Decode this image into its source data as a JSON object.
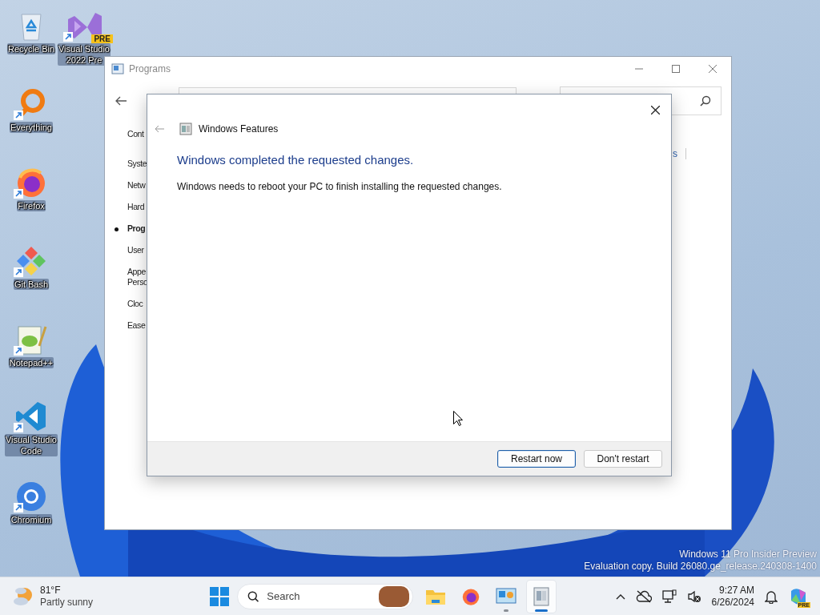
{
  "desktop_icons": [
    {
      "label": "Recycle Bin",
      "kind": "recycle",
      "shortcut": false
    },
    {
      "label": "Visual Studio\n2022 Pre",
      "kind": "vs-preview",
      "shortcut": true,
      "badge": "PRE"
    },
    {
      "label": "Everything",
      "kind": "everything",
      "shortcut": true
    },
    {
      "label": "Firefox",
      "kind": "firefox",
      "shortcut": true
    },
    {
      "label": "Git Bash",
      "kind": "gitbash",
      "shortcut": true
    },
    {
      "label": "Notepad++",
      "kind": "notepad",
      "shortcut": true
    },
    {
      "label": "Visual Studio\nCode",
      "kind": "vscode",
      "shortcut": true
    },
    {
      "label": "Chromium",
      "kind": "chromium",
      "shortcut": true
    }
  ],
  "programs_window": {
    "title": "Programs",
    "sidebar": [
      {
        "label": "Cont",
        "selected": false
      },
      {
        "label": "Syste",
        "selected": false
      },
      {
        "label": "Netw",
        "selected": false
      },
      {
        "label": "Hard",
        "selected": false
      },
      {
        "label": "Prog",
        "selected": true
      },
      {
        "label": "User",
        "selected": false
      },
      {
        "label": "Appe\nPerso",
        "selected": false
      },
      {
        "label": "Cloc",
        "selected": false
      },
      {
        "label": "Ease",
        "selected": false
      }
    ],
    "right_link": "s"
  },
  "dialog": {
    "title": "Windows Features",
    "heading": "Windows completed the requested changes.",
    "message": "Windows needs to reboot your PC to finish installing the requested changes.",
    "buttons": [
      {
        "label": "Restart now",
        "default": true
      },
      {
        "label": "Don't restart",
        "default": false
      }
    ]
  },
  "watermark": {
    "line1": "Windows 11 Pro Insider Preview",
    "line2": "Evaluation copy. Build 26080.ge_release.240308-1400"
  },
  "taskbar": {
    "weather": {
      "temperature": "81°F",
      "condition": "Partly sunny"
    },
    "search": {
      "placeholder": "Search"
    },
    "apps": [
      {
        "kind": "folder",
        "running": false,
        "active": false
      },
      {
        "kind": "firefox",
        "running": false,
        "active": false
      },
      {
        "kind": "control-panel",
        "running": true,
        "active": false
      },
      {
        "kind": "features",
        "running": true,
        "active": true
      }
    ],
    "time": "9:27 AM",
    "date": "6/26/2024",
    "copilot_badge": "PRE"
  }
}
